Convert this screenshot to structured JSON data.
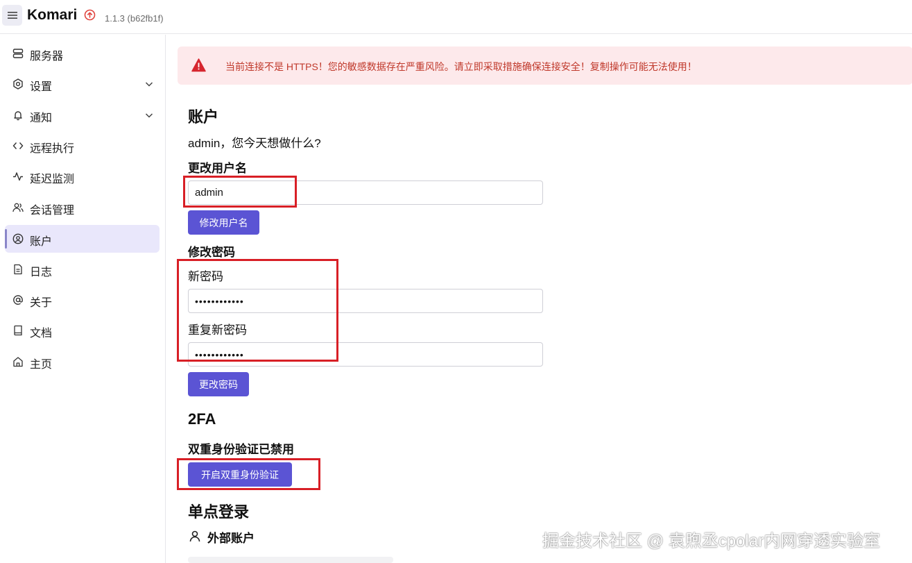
{
  "header": {
    "brand": "Komari",
    "version": "1.1.3 (b62fb1f)",
    "menu_icon": "hamburger-icon",
    "update_icon": "update-available-icon"
  },
  "sidebar": {
    "items": [
      {
        "label": "服务器",
        "icon": "server-icon",
        "expandable": false,
        "active": false
      },
      {
        "label": "设置",
        "icon": "settings-icon",
        "expandable": true,
        "active": false
      },
      {
        "label": "通知",
        "icon": "bell-icon",
        "expandable": true,
        "active": false
      },
      {
        "label": "远程执行",
        "icon": "code-icon",
        "expandable": false,
        "active": false
      },
      {
        "label": "延迟监测",
        "icon": "activity-icon",
        "expandable": false,
        "active": false
      },
      {
        "label": "会话管理",
        "icon": "users-icon",
        "expandable": false,
        "active": false
      },
      {
        "label": "账户",
        "icon": "user-circle-icon",
        "expandable": false,
        "active": true
      },
      {
        "label": "日志",
        "icon": "file-text-icon",
        "expandable": false,
        "active": false
      },
      {
        "label": "关于",
        "icon": "at-sign-icon",
        "expandable": false,
        "active": false
      },
      {
        "label": "文档",
        "icon": "book-icon",
        "expandable": false,
        "active": false
      },
      {
        "label": "主页",
        "icon": "home-icon",
        "expandable": false,
        "active": false
      }
    ]
  },
  "alert": {
    "icon": "warning-triangle-icon",
    "message": "当前连接不是 HTTPS！您的敏感数据存在严重风险。请立即采取措施确保连接安全！复制操作可能无法使用！"
  },
  "account": {
    "title": "账户",
    "greeting": "admin，您今天想做什么?",
    "username_section": "更改用户名",
    "username_value": "admin",
    "username_button": "修改用户名",
    "password_section": "修改密码",
    "new_password_label": "新密码",
    "new_password_value": "••••••••••••",
    "repeat_password_label": "重复新密码",
    "repeat_password_value": "••••••••••••",
    "password_button": "更改密码"
  },
  "twofa": {
    "title": "2FA",
    "status": "双重身份验证已禁用",
    "enable_button": "开启双重身份验证"
  },
  "sso": {
    "title": "单点登录",
    "external_accounts": "外部账户",
    "external_icon": "user-icon"
  },
  "watermark": "掘金技术社区 @ 袁煦丞cpolar内网穿透实验室",
  "colors": {
    "primary": "#5b54d4",
    "alert_bg": "#fde9eb",
    "alert_text": "#c0392b",
    "annotation": "#d81f26",
    "active_nav_bg": "#e9e7fb"
  }
}
